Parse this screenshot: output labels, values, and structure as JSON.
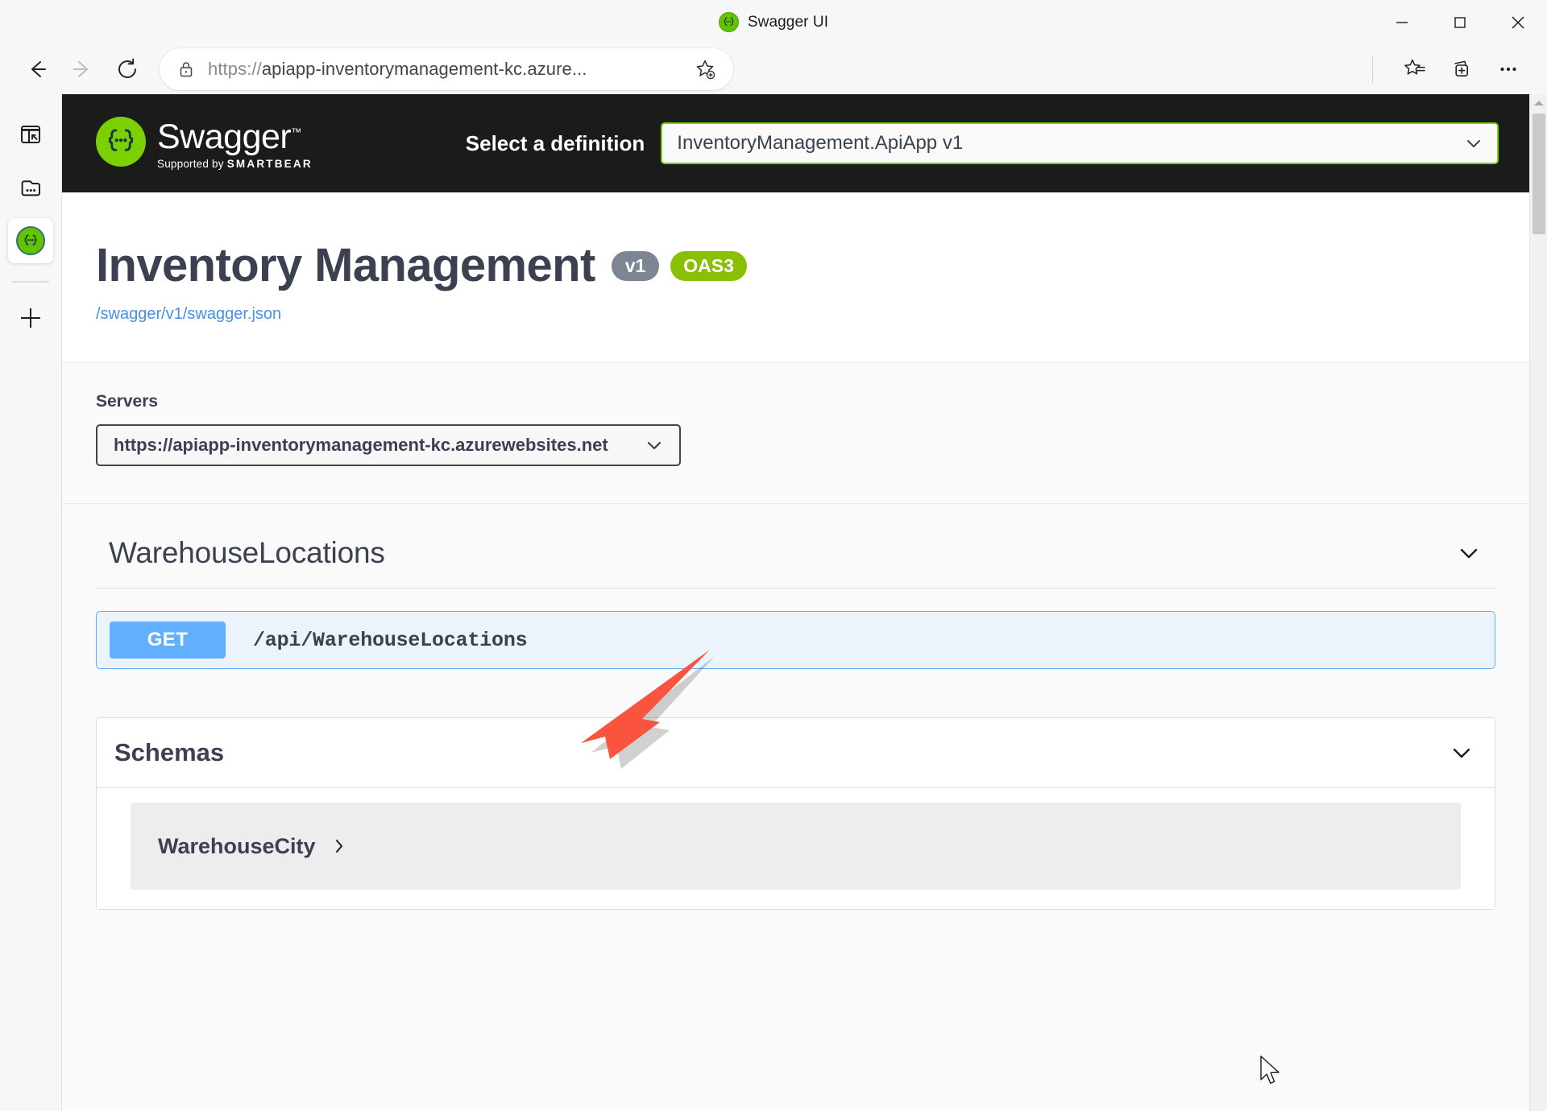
{
  "window": {
    "tab_title": "Swagger UI",
    "favicon_name": "swagger-favicon",
    "minimize_label": "Minimize",
    "maximize_label": "Maximize",
    "close_label": "Close"
  },
  "toolbar": {
    "back_label": "Back",
    "forward_label": "Forward",
    "refresh_label": "Refresh",
    "url_scheme": "https://",
    "url_rest": "apiapp-inventorymanagement-kc.azure...",
    "url_full": "https://apiapp-inventorymanagement-kc.azure...",
    "lock_icon": "lock-icon",
    "favorite_icon": "add-favorite-icon",
    "favorites_icon": "favorites-icon",
    "collections_icon": "collections-icon",
    "settings_icon": "settings-more-icon"
  },
  "sidebar": {
    "items": [
      {
        "icon": "split-screen-icon",
        "label": "Split screen"
      },
      {
        "icon": "tab-actions-icon",
        "label": "Tab actions"
      },
      {
        "icon": "swagger-ui-tab-icon",
        "label": "Swagger UI"
      }
    ],
    "add_tab_label": "+"
  },
  "swagger": {
    "logo": {
      "word": "Swagger",
      "trademark": "™",
      "supported_prefix": "Supported by",
      "supported_brand": "SMARTBEAR",
      "mark": "{...}"
    },
    "definition": {
      "label": "Select a definition",
      "selected": "InventoryManagement.ApiApp v1",
      "chevron": "chevron-down-icon"
    },
    "info": {
      "title": "Inventory Management",
      "version_badge": "v1",
      "oas_badge": "OAS3",
      "spec_link": "/swagger/v1/swagger.json"
    },
    "servers": {
      "label": "Servers",
      "selected": "https://apiapp-inventorymanagement-kc.azurewebsites.net",
      "chevron": "chevron-down-icon"
    },
    "tags": [
      {
        "name": "WarehouseLocations",
        "collapse_icon": "chevron-down-icon",
        "operations": [
          {
            "method": "GET",
            "path": "/api/WarehouseLocations"
          }
        ]
      }
    ],
    "schemas": {
      "title": "Schemas",
      "collapse_icon": "chevron-down-icon",
      "models": [
        {
          "name": "WarehouseCity",
          "expand_icon": "chevron-right-icon"
        }
      ]
    }
  },
  "colors": {
    "swagger_green": "#7ad001",
    "oas_green": "#89bf04",
    "get_blue": "#61affe",
    "topbar_dark": "#1b1b1b",
    "text_slate": "#3b4151",
    "link_blue": "#4990e2",
    "annotation_red": "#f8543e"
  }
}
